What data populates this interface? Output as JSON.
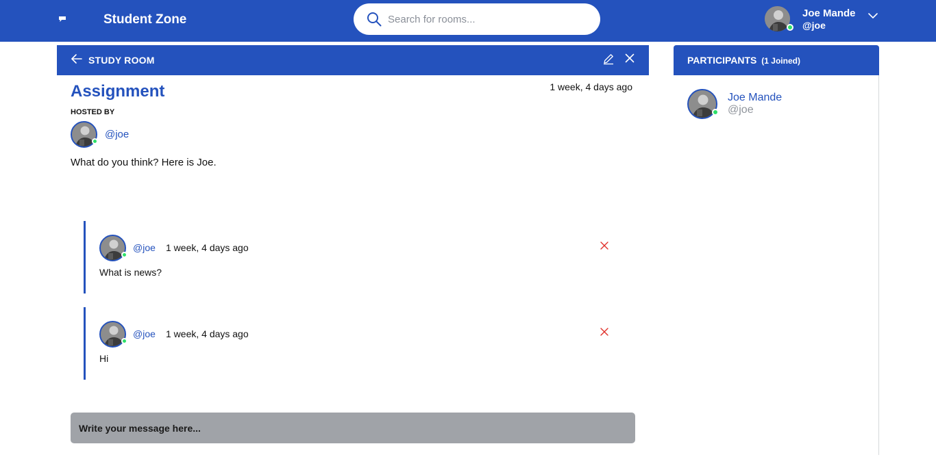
{
  "app": {
    "brand": "Student Zone"
  },
  "search": {
    "placeholder": "Search for rooms..."
  },
  "user": {
    "name": "Joe Mande",
    "handle": "@joe"
  },
  "room": {
    "header_label": "STUDY ROOM",
    "title": "Assignment",
    "time": "1 week, 4 days ago",
    "hosted_by_label": "HOSTED BY",
    "host_handle": "@joe",
    "description": "What do you think? Here is Joe."
  },
  "messages": [
    {
      "handle": "@joe",
      "time": "1 week, 4 days ago",
      "body": "What is news?"
    },
    {
      "handle": "@joe",
      "time": "1 week, 4 days ago",
      "body": "Hi"
    }
  ],
  "composer": {
    "placeholder": "Write your message here..."
  },
  "participants": {
    "label": "PARTICIPANTS",
    "count_label": "(1 Joined)",
    "items": [
      {
        "name": "Joe Mande",
        "handle": "@joe"
      }
    ]
  },
  "colors": {
    "primary": "#2452bd",
    "online": "#2ee06a",
    "danger": "#e0302a",
    "composer_bg": "#a0a3a8"
  },
  "icons": [
    "logo-icon",
    "search-icon",
    "chevron-down-icon",
    "back-arrow-icon",
    "edit-icon",
    "close-icon",
    "delete-icon"
  ]
}
